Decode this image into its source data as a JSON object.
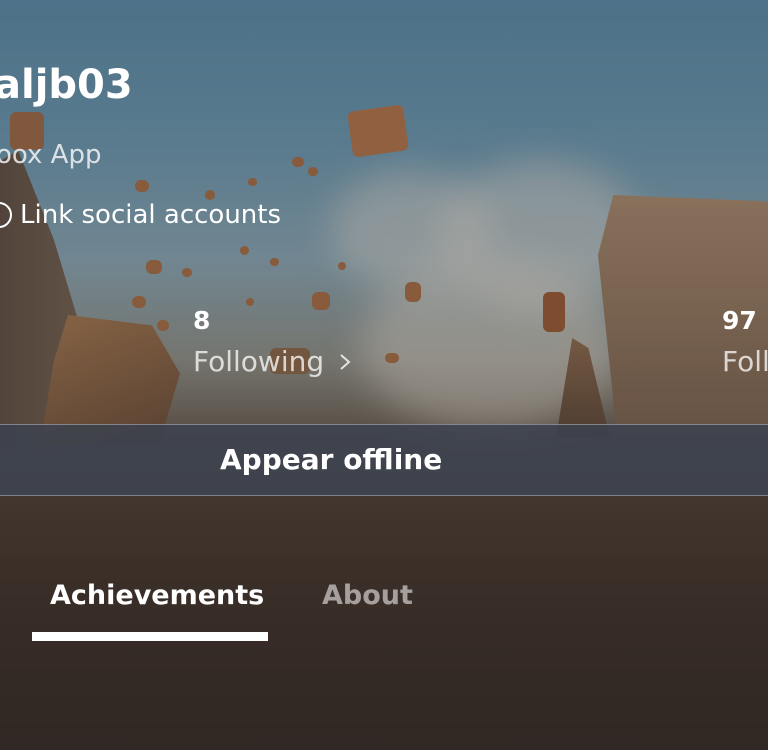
{
  "profile": {
    "gamertag": "aljb03",
    "app_label": "oox App",
    "link_social_label": "Link social accounts"
  },
  "stats": {
    "following": {
      "count": "8",
      "label": "Following"
    },
    "followers": {
      "count": "97",
      "label": "Follo"
    }
  },
  "presence": {
    "appear_offline_label": "Appear offline"
  },
  "tabs": [
    {
      "label": "Achievements",
      "selected": true
    },
    {
      "label": "About",
      "selected": false
    }
  ],
  "colors": {
    "text_primary": "#ffffff",
    "bar_background": "#3c424e",
    "tab_indicator": "#ffffff"
  }
}
